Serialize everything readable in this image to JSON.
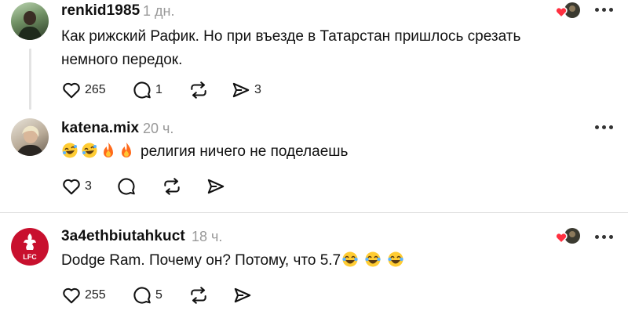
{
  "posts": [
    {
      "author": "renkid1985",
      "time": "1 дн.",
      "text": "Как рижский Рафик. Но при въезде в Татарстан пришлось срезать немного передок.",
      "likes": "265",
      "replies": "1",
      "reposts": "",
      "shares": "3"
    },
    {
      "author": "katena.mix",
      "time": "20 ч.",
      "text": "религия ничего не поделаешь",
      "likes": "3",
      "replies": "",
      "reposts": "",
      "shares": ""
    },
    {
      "author": "3a4ethbiutahkuct",
      "time": "18 ч.",
      "text": "Dodge Ram. Почему он? Потому, что 5.7",
      "avatar_text": "LFC",
      "likes": "255",
      "replies": "5",
      "reposts": "",
      "shares": ""
    }
  ],
  "icons": {
    "like": "heart-outline-icon",
    "reply": "comment-bubble-icon",
    "repost": "repost-arrows-icon",
    "share": "send-paper-plane-icon",
    "more": "more-horizontal-icon",
    "liked_by_author": "heart-badge-icon"
  },
  "colors": {
    "text": "#101010",
    "muted": "#999999",
    "like_red": "#ff3040",
    "lfc_red": "#c8102e"
  }
}
